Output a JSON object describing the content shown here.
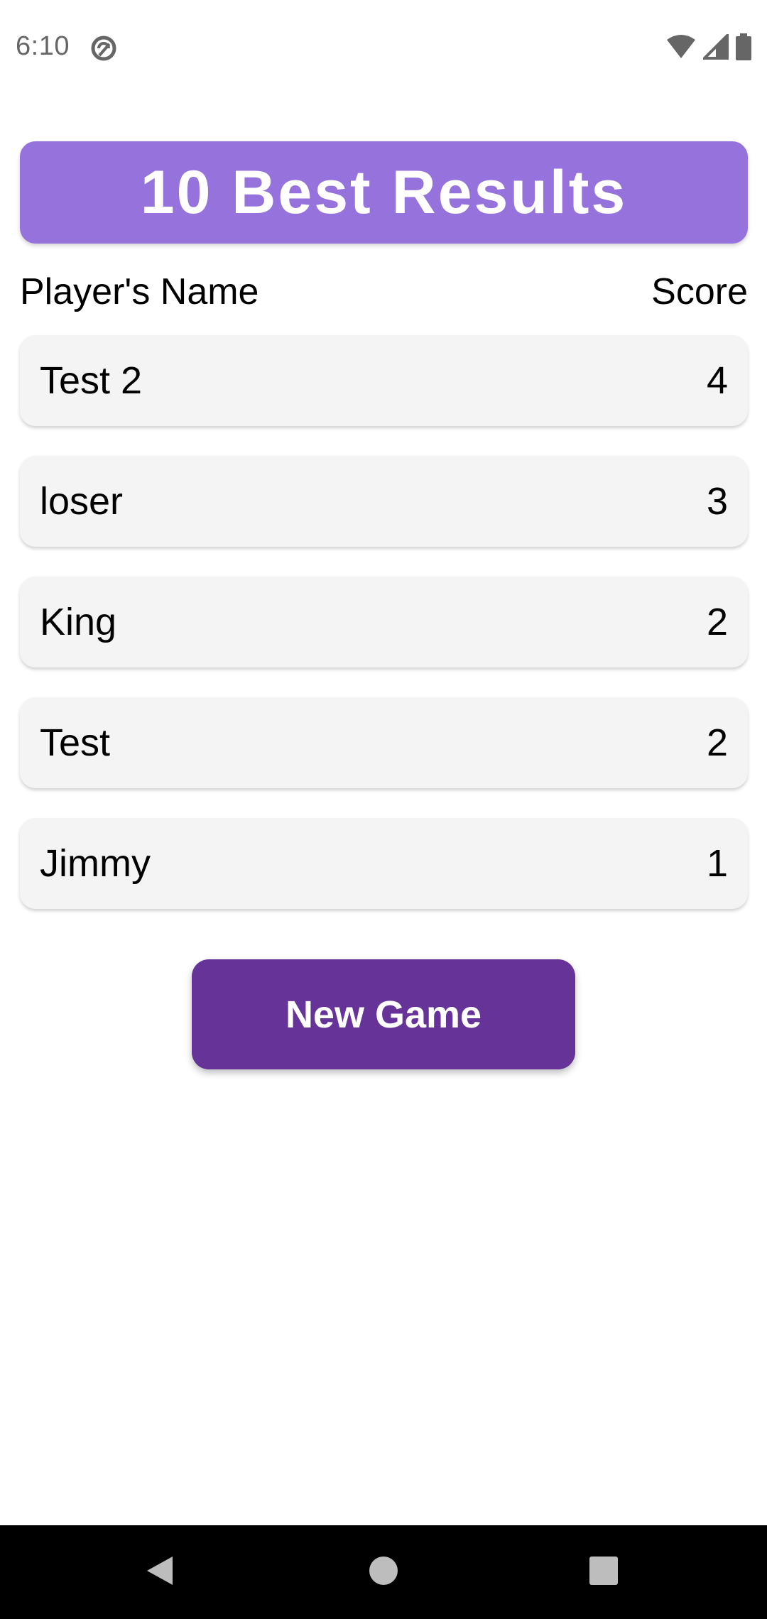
{
  "status_bar": {
    "time": "6:10",
    "icons": [
      "app-notification-icon",
      "wifi-icon",
      "cellular-signal-icon",
      "battery-icon"
    ]
  },
  "header": {
    "title": "10 Best Results",
    "accent_color": "#9572dc"
  },
  "columns": {
    "name": "Player's Name",
    "score": "Score"
  },
  "results": [
    {
      "name": "Test 2",
      "score": "4"
    },
    {
      "name": "loser",
      "score": "3"
    },
    {
      "name": "King",
      "score": "2"
    },
    {
      "name": "Test",
      "score": "2"
    },
    {
      "name": "Jimmy",
      "score": "1"
    }
  ],
  "actions": {
    "new_game_label": "New Game",
    "button_color": "#663399"
  },
  "nav_bar": {
    "icons": [
      "back-icon",
      "home-icon",
      "recents-icon"
    ]
  }
}
